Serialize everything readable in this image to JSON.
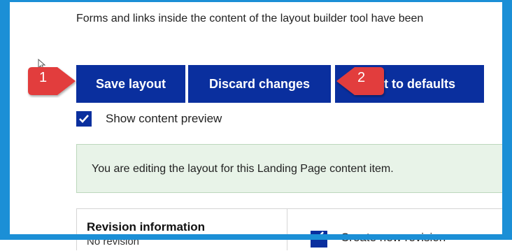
{
  "intro_text": "Forms and links inside the content of the layout builder tool have been",
  "actions": {
    "save_label": "Save layout",
    "discard_label": "Discard changes",
    "revert_label_visible": "rt to defaults"
  },
  "preview": {
    "label": "Show content preview",
    "checked": true
  },
  "status_message": "You are editing the layout for this Landing Page content item.",
  "revision": {
    "title": "Revision information",
    "subtitle": "No revision",
    "new_revision_label": "Create new revision",
    "new_revision_checked": true
  },
  "callouts": [
    {
      "number": "1",
      "color": "#e23c3c"
    },
    {
      "number": "2",
      "color": "#e23c3c"
    }
  ],
  "colors": {
    "button_bg": "#0a2f9e",
    "frame": "#1b8fd6",
    "message_bg": "#e8f3e8"
  }
}
